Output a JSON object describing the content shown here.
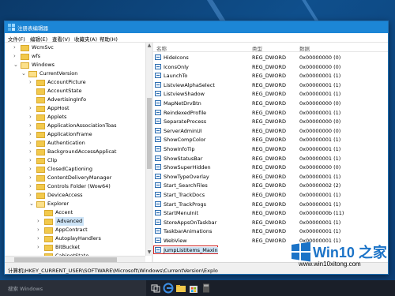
{
  "window": {
    "title": "注册表编辑器",
    "menu": [
      "文件(F)",
      "编辑(E)",
      "查看(V)",
      "收藏夹(A)",
      "帮助(H)"
    ]
  },
  "tree": {
    "items": [
      {
        "label": "WcmSvc",
        "level": 3,
        "expanded": false,
        "has_children": true
      },
      {
        "label": "wfs",
        "level": 3,
        "expanded": false,
        "has_children": true
      },
      {
        "label": "Windows",
        "level": 3,
        "expanded": true,
        "has_children": true
      },
      {
        "label": "CurrentVersion",
        "level": 4,
        "expanded": true,
        "has_children": true
      },
      {
        "label": "AccountPicture",
        "level": 5,
        "expanded": false,
        "has_children": true
      },
      {
        "label": "AccountState",
        "level": 5,
        "expanded": false,
        "has_children": false
      },
      {
        "label": "AdvertisingInfo",
        "level": 5,
        "expanded": false,
        "has_children": false
      },
      {
        "label": "AppHost",
        "level": 5,
        "expanded": false,
        "has_children": true
      },
      {
        "label": "Applets",
        "level": 5,
        "expanded": false,
        "has_children": true
      },
      {
        "label": "ApplicationAssociationToas",
        "level": 5,
        "expanded": false,
        "has_children": true
      },
      {
        "label": "ApplicationFrame",
        "level": 5,
        "expanded": false,
        "has_children": true
      },
      {
        "label": "Authentication",
        "level": 5,
        "expanded": false,
        "has_children": true
      },
      {
        "label": "BackgroundAccessApplicat",
        "level": 5,
        "expanded": false,
        "has_children": true
      },
      {
        "label": "Clip",
        "level": 5,
        "expanded": false,
        "has_children": true
      },
      {
        "label": "ClosedCaptioning",
        "level": 5,
        "expanded": false,
        "has_children": true
      },
      {
        "label": "ContentDeliveryManager",
        "level": 5,
        "expanded": false,
        "has_children": true
      },
      {
        "label": "Controls Folder (Wow64)",
        "level": 5,
        "expanded": false,
        "has_children": true
      },
      {
        "label": "DeviceAccess",
        "level": 5,
        "expanded": false,
        "has_children": true
      },
      {
        "label": "Explorer",
        "level": 5,
        "expanded": true,
        "has_children": true
      },
      {
        "label": "Accent",
        "level": 6,
        "expanded": false,
        "has_children": false
      },
      {
        "label": "Advanced",
        "level": 6,
        "expanded": false,
        "has_children": true,
        "selected": true
      },
      {
        "label": "AppContract",
        "level": 6,
        "expanded": false,
        "has_children": true
      },
      {
        "label": "AutoplayHandlers",
        "level": 6,
        "expanded": false,
        "has_children": true
      },
      {
        "label": "BitBucket",
        "level": 6,
        "expanded": false,
        "has_children": true
      },
      {
        "label": "CabinetState",
        "level": 6,
        "expanded": false,
        "has_children": false
      }
    ]
  },
  "list": {
    "headers": {
      "name": "名称",
      "type": "类型",
      "data": "数据"
    },
    "rows": [
      {
        "name": "HideIcons",
        "type": "REG_DWORD",
        "data": "0x00000000 (0)"
      },
      {
        "name": "IconsOnly",
        "type": "REG_DWORD",
        "data": "0x00000000 (0)"
      },
      {
        "name": "LaunchTo",
        "type": "REG_DWORD",
        "data": "0x00000001 (1)"
      },
      {
        "name": "ListviewAlphaSelect",
        "type": "REG_DWORD",
        "data": "0x00000001 (1)"
      },
      {
        "name": "ListviewShadow",
        "type": "REG_DWORD",
        "data": "0x00000001 (1)"
      },
      {
        "name": "MapNetDrvBtn",
        "type": "REG_DWORD",
        "data": "0x00000000 (0)"
      },
      {
        "name": "ReindexedProfile",
        "type": "REG_DWORD",
        "data": "0x00000001 (1)"
      },
      {
        "name": "SeparateProcess",
        "type": "REG_DWORD",
        "data": "0x00000000 (0)"
      },
      {
        "name": "ServerAdminUI",
        "type": "REG_DWORD",
        "data": "0x00000000 (0)"
      },
      {
        "name": "ShowCompColor",
        "type": "REG_DWORD",
        "data": "0x00000001 (1)"
      },
      {
        "name": "ShowInfoTip",
        "type": "REG_DWORD",
        "data": "0x00000001 (1)"
      },
      {
        "name": "ShowStatusBar",
        "type": "REG_DWORD",
        "data": "0x00000001 (1)"
      },
      {
        "name": "ShowSuperHidden",
        "type": "REG_DWORD",
        "data": "0x00000000 (0)"
      },
      {
        "name": "ShowTypeOverlay",
        "type": "REG_DWORD",
        "data": "0x00000001 (1)"
      },
      {
        "name": "Start_SearchFiles",
        "type": "REG_DWORD",
        "data": "0x00000002 (2)"
      },
      {
        "name": "Start_TrackDocs",
        "type": "REG_DWORD",
        "data": "0x00000001 (1)"
      },
      {
        "name": "Start_TrackProgs",
        "type": "REG_DWORD",
        "data": "0x00000001 (1)"
      },
      {
        "name": "StartMenuInit",
        "type": "REG_DWORD",
        "data": "0x0000000b (11)"
      },
      {
        "name": "StoreAppsOnTaskbar",
        "type": "REG_DWORD",
        "data": "0x00000001 (1)"
      },
      {
        "name": "TaskbarAnimations",
        "type": "REG_DWORD",
        "data": "0x00000001 (1)"
      },
      {
        "name": "WebView",
        "type": "REG_DWORD",
        "data": "0x00000001 (1)"
      },
      {
        "name": "JumpListItems_Maxin",
        "type": "",
        "data": "",
        "highlighted": true
      }
    ]
  },
  "status_bar": {
    "path": "计算机\\HKEY_CURRENT_USER\\SOFTWARE\\Microsoft\\Windows\\CurrentVersion\\Explo"
  },
  "taskbar": {
    "search_text": "搜索 Windows",
    "icons": [
      "task-view-icon",
      "edge-icon",
      "file-explorer-icon",
      "store-icon",
      "calculator-icon"
    ]
  },
  "watermark": {
    "brand": "Win10 之家",
    "url": "www.win10xitong.com"
  },
  "colors": {
    "titlebar": "#1c86d6",
    "selection": "#cde4f7",
    "highlight_outline": "#d0201f",
    "watermark": "#1b73c7"
  }
}
